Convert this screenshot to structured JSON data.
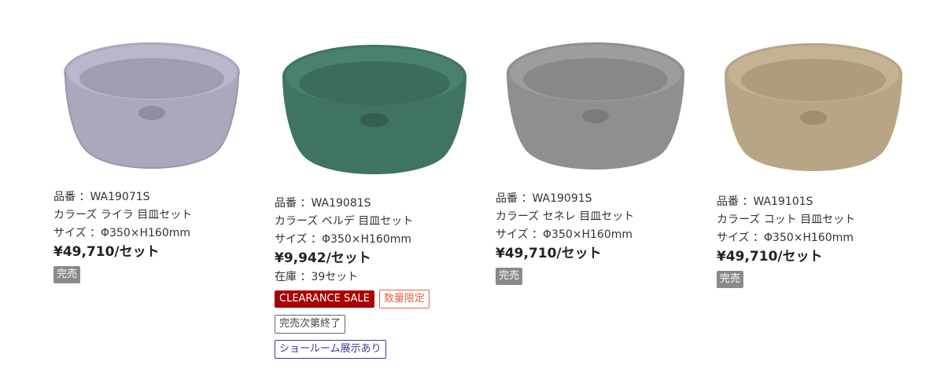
{
  "products": [
    {
      "product_no": "品番 ：WA19071S",
      "color": "カラーズ ライラ 目皿セット",
      "size": "サイズ ：Φ350×H160mm",
      "price": "¥49,710/セット",
      "status": "完売",
      "bowl_color": "#a9a8bc"
    },
    {
      "product_no": "品番 ：WA19081S",
      "color": "カラーズ ベルデ 目皿セット",
      "size": "サイズ ：Φ350×H160mm",
      "price": "¥9,942/セット",
      "stock": "在庫 ：39セット",
      "badges": {
        "clearance": "CLEARANCE SALE",
        "limited": "数量限定",
        "end": "完売次第終了",
        "showroom": "ショールーム展示あり"
      },
      "bowl_color": "#3f7462"
    },
    {
      "product_no": "品番 ：WA19091S",
      "color": "カラーズ セネレ 目皿セット",
      "size": "サイズ ：Φ350×H160mm",
      "price": "¥49,710/セット",
      "status": "完売",
      "bowl_color": "#8f8f8f"
    },
    {
      "product_no": "品番 ：WA19101S",
      "color": "カラーズ コット 目皿セット",
      "size": "サイズ ：Φ350×H160mm",
      "price": "¥49,710/セット",
      "status": "完売",
      "bowl_color": "#b7a585"
    }
  ]
}
